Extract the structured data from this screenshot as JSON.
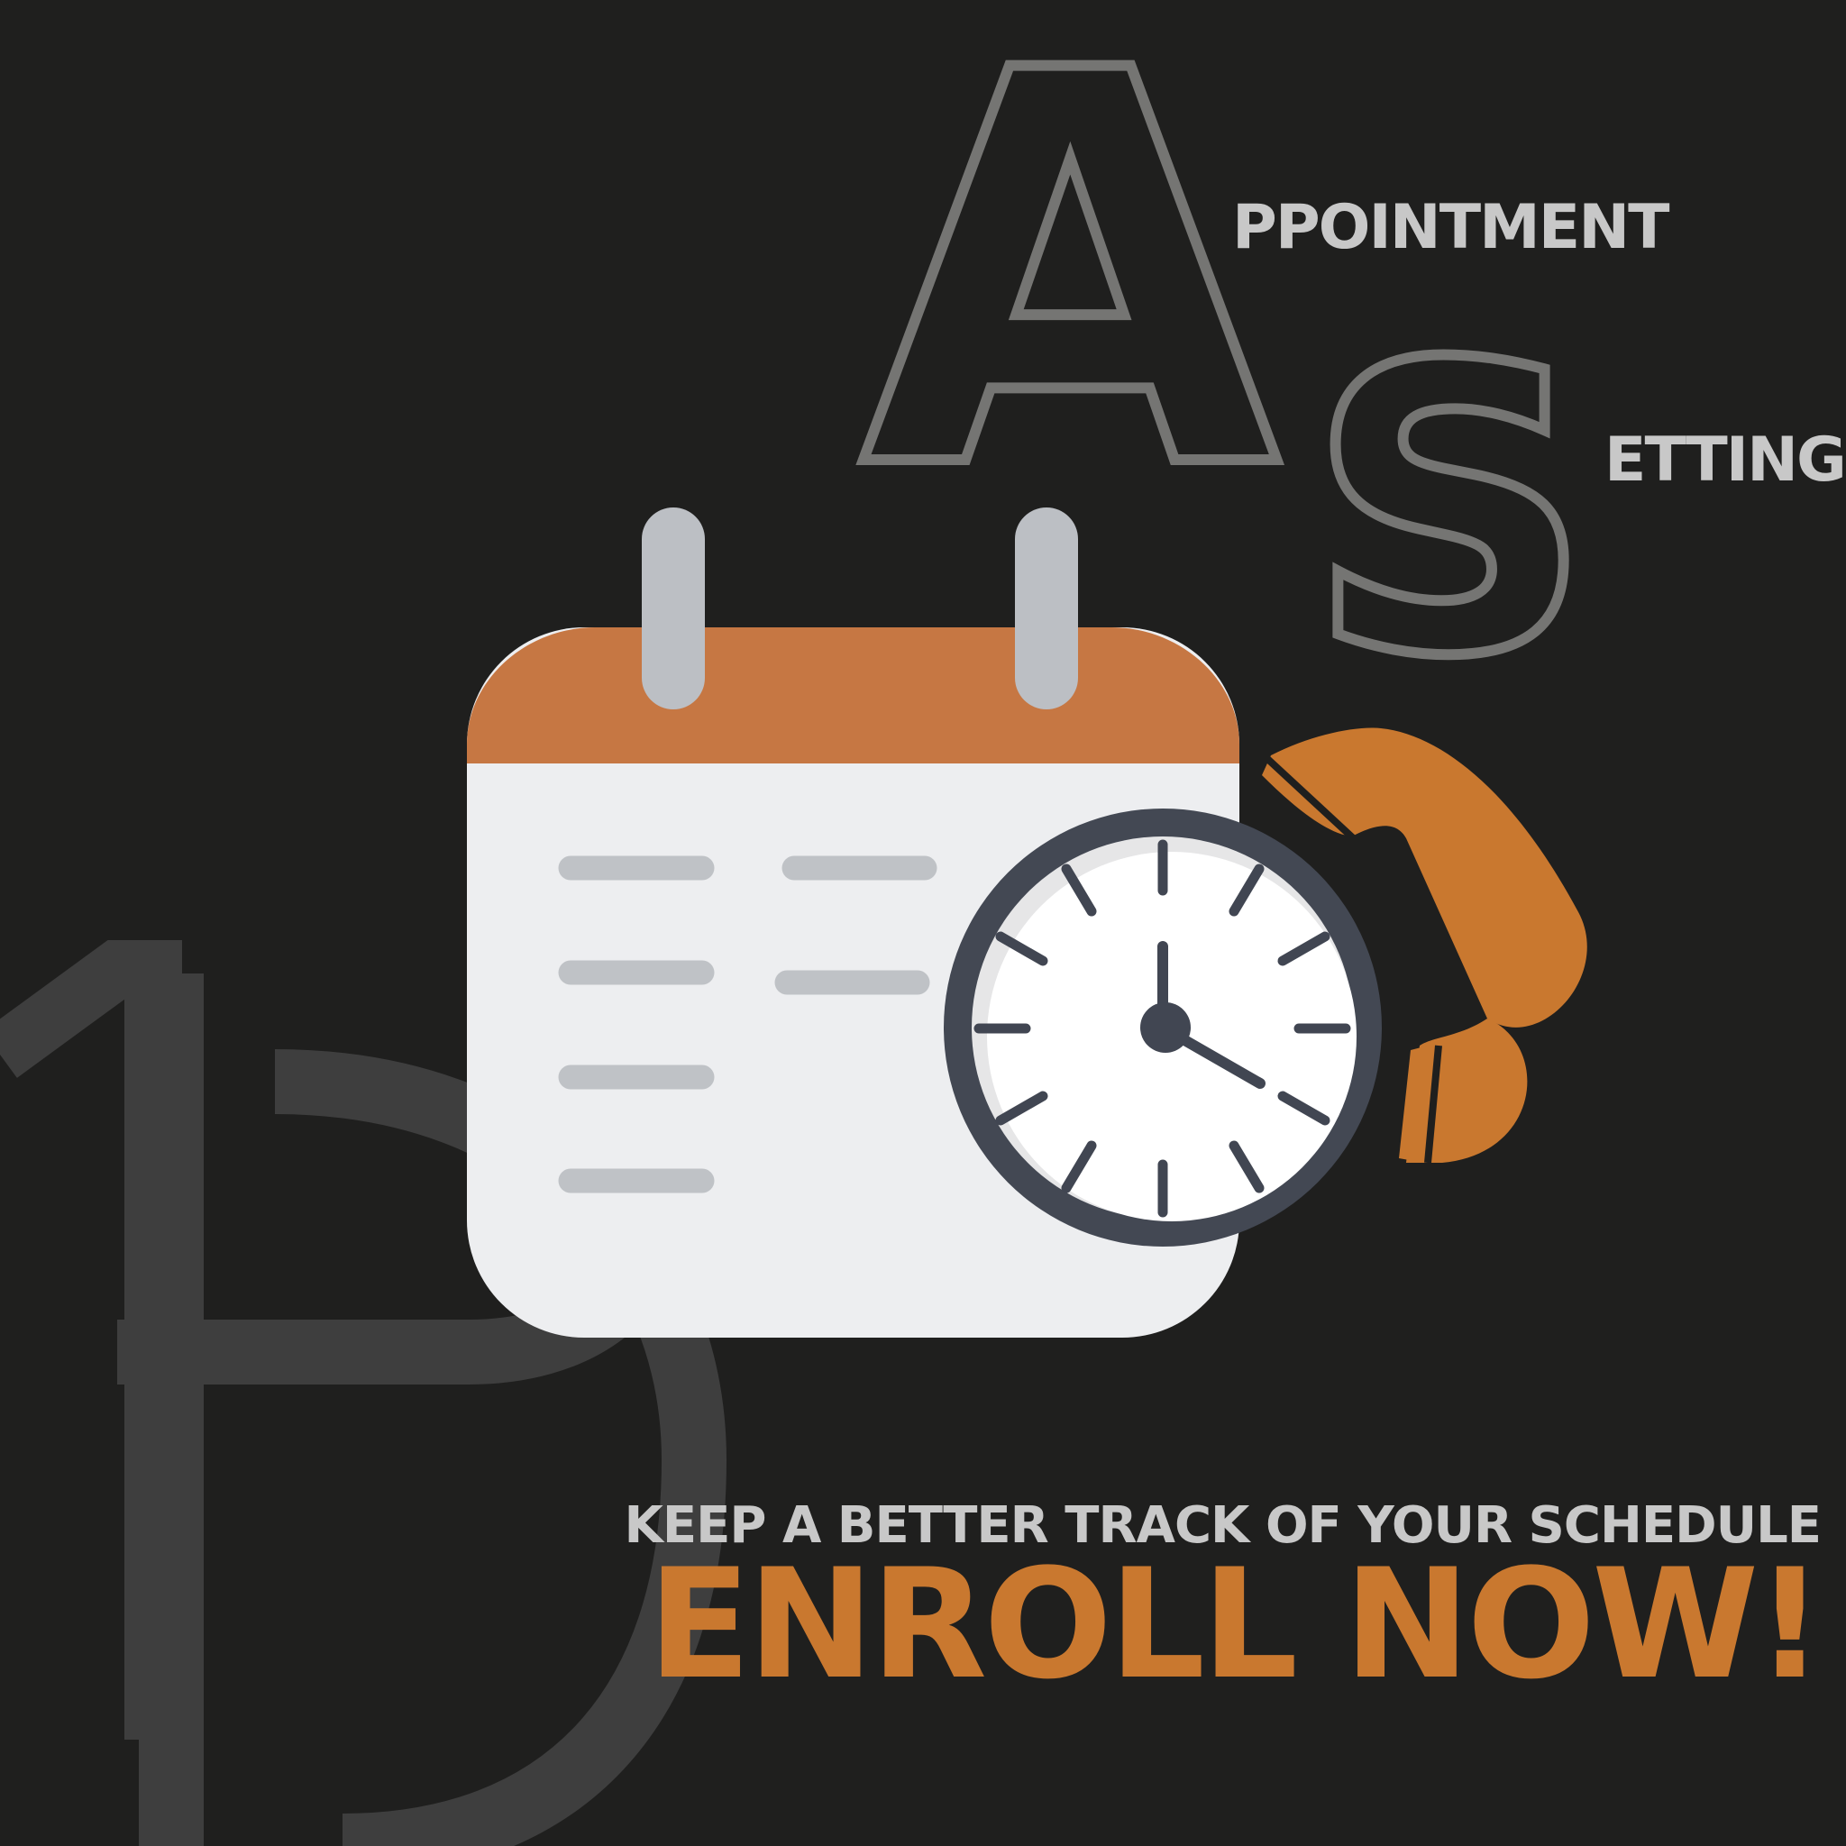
{
  "title": {
    "initial_a": "A",
    "rest_a": "PPOINTMENT",
    "initial_s": "S",
    "rest_s": "ETTING"
  },
  "tagline": "KEEP A BETTER TRACK OF YOUR SCHEDULE",
  "cta": "ENROLL NOW!",
  "colors": {
    "background": "#1f1f1e",
    "accent": "#c9782f",
    "calendar_header": "#c67743",
    "outline_letters": "#757573",
    "light_text": "#c8c8c8",
    "watermark": "#3e3e3e"
  },
  "icons": [
    "logo-watermark",
    "calendar-icon",
    "clock-icon",
    "phone-handset-icon"
  ]
}
